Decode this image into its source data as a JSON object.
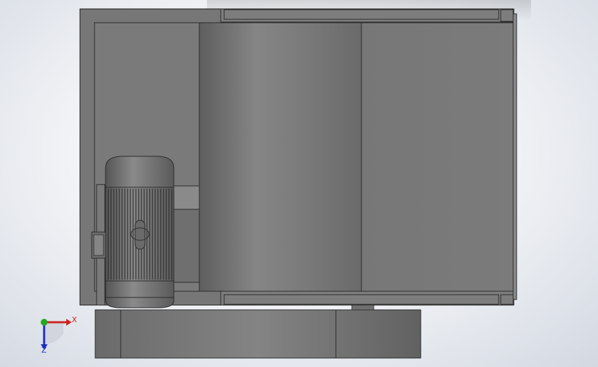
{
  "viewport": {
    "view": "Top view",
    "background_color": "#f4f5f7",
    "model_color": "#7a7a7a"
  },
  "triad": {
    "x_label": "X",
    "z_label": "Z",
    "x_color": "#cc2222",
    "y_color": "#22aa22",
    "z_color": "#1a2ec0"
  }
}
